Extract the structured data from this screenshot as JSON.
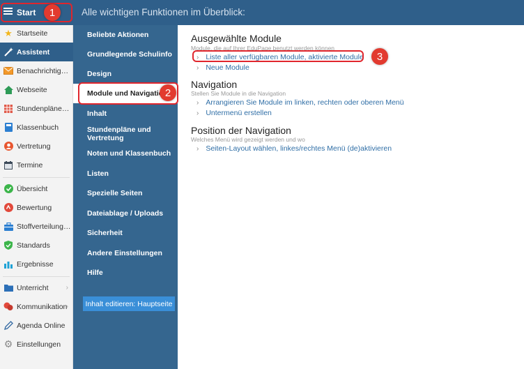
{
  "sidebar": {
    "start_label": "Start",
    "items": [
      {
        "label": "Startseite",
        "icon": "star-icon"
      },
      {
        "label": "Assistent",
        "icon": "magic-wand-icon"
      },
      {
        "label": "Benachrichtigungen",
        "icon": "envelope-icon"
      },
      {
        "label": "Webseite",
        "icon": "home-icon"
      },
      {
        "label": "Stundenpläne und Vertretung",
        "icon": "timetable-icon"
      },
      {
        "label": "Klassenbuch",
        "icon": "book-icon"
      },
      {
        "label": "Vertretung",
        "icon": "person-icon"
      },
      {
        "label": "Termine",
        "icon": "calendar-icon"
      },
      {
        "label": "Übersicht",
        "icon": "check-circle-icon"
      },
      {
        "label": "Bewertung",
        "icon": "grade-icon"
      },
      {
        "label": "Stoffverteilungsplan",
        "icon": "briefcase-icon"
      },
      {
        "label": "Standards",
        "icon": "shield-icon"
      },
      {
        "label": "Ergebnisse",
        "icon": "bar-chart-icon"
      },
      {
        "label": "Unterricht",
        "icon": "folder-icon"
      },
      {
        "label": "Kommunikation",
        "icon": "chat-icon"
      },
      {
        "label": "Agenda Online",
        "icon": "pen-icon"
      },
      {
        "label": "Einstellungen",
        "icon": "gear-icon"
      }
    ]
  },
  "header": {
    "title": "Alle wichtigen Funktionen im Überblick:"
  },
  "menu": {
    "items": [
      "Beliebte Aktionen",
      "Grundlegende Schulinfo",
      "Design",
      "Module und Navigation",
      "Inhalt",
      "Stundenpläne und Vertretung",
      "Noten und Klassenbuch",
      "Listen",
      "Spezielle Seiten",
      "Dateiablage / Uploads",
      "Sicherheit",
      "Andere Einstellungen",
      "Hilfe"
    ],
    "selected": "Module und Navigation",
    "edit_button": "Inhalt editieren: Hauptseite"
  },
  "main": {
    "sections": [
      {
        "title": "Ausgewählte Module",
        "subtitle": "Module, die auf Ihrer EduPage benutzt werden können",
        "links": [
          "Liste aller verfügbaren Module, aktivierte Module",
          "Neue Module"
        ]
      },
      {
        "title": "Navigation",
        "subtitle": "Stellen Sie Module in die Navigation",
        "links": [
          "Arrangieren Sie Module im linken, rechten oder oberen Menü",
          "Untermenü erstellen"
        ]
      },
      {
        "title": "Position der Navigation",
        "subtitle": "Welches Menü wird gezeigt werden und wo",
        "links": [
          "Seiten-Layout wählen, linkes/rechtes Menü (de)aktivieren"
        ]
      }
    ]
  },
  "annotations": {
    "badges": [
      "1",
      "2",
      "3"
    ],
    "color": "#e0262d"
  },
  "colors": {
    "header_blue": "#2f5f8a",
    "menu_blue": "#35668f",
    "link_blue": "#2f6ea6",
    "button_blue": "#3a8fd8"
  }
}
